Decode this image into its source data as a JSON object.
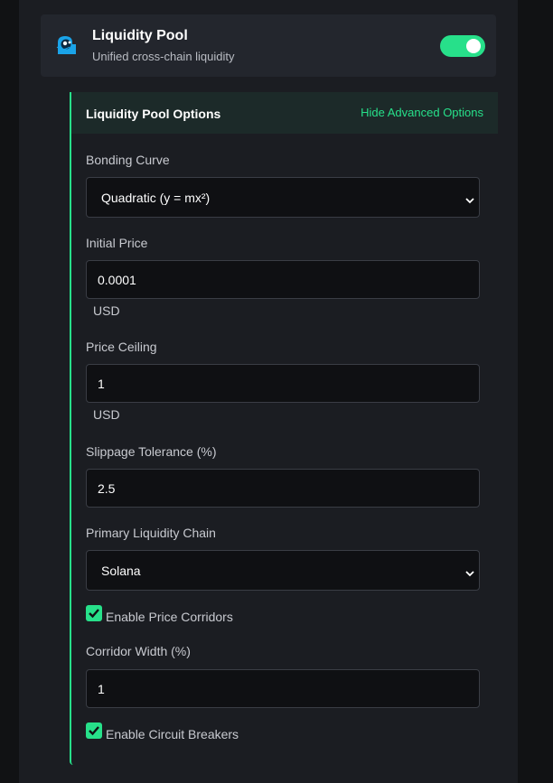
{
  "feature": {
    "title": "Liquidity Pool",
    "subtitle": "Unified cross-chain liquidity",
    "enabled": true,
    "icon": "pool-logo-icon"
  },
  "options": {
    "title": "Liquidity Pool Options",
    "hide_link": "Hide Advanced Options"
  },
  "fields": {
    "bonding_curve": {
      "label": "Bonding Curve",
      "value": "Quadratic (y = mx²)"
    },
    "initial_price": {
      "label": "Initial Price",
      "value": "0.0001",
      "unit": "USD"
    },
    "price_ceiling": {
      "label": "Price Ceiling",
      "value": "1",
      "unit": "USD"
    },
    "slippage": {
      "label": "Slippage Tolerance (%)",
      "value": "2.5"
    },
    "primary_chain": {
      "label": "Primary Liquidity Chain",
      "value": "Solana"
    },
    "price_corridors": {
      "label": "Enable Price Corridors",
      "checked": true
    },
    "corridor_width": {
      "label": "Corridor Width (%)",
      "value": "1"
    },
    "circuit_breakers": {
      "label": "Enable Circuit Breakers",
      "checked": true
    }
  },
  "colors": {
    "accent": "#27e08a",
    "icon_blue": "#1aa3e8"
  }
}
